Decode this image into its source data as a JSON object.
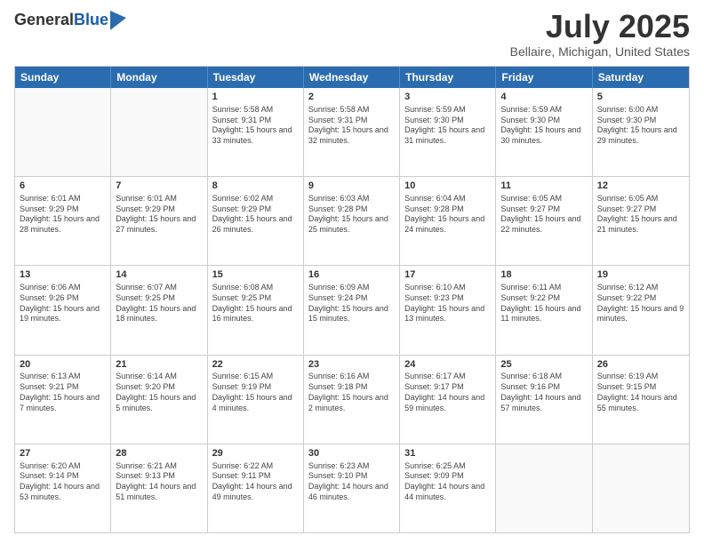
{
  "logo": {
    "general": "General",
    "blue": "Blue"
  },
  "header": {
    "month": "July 2025",
    "location": "Bellaire, Michigan, United States"
  },
  "days": [
    "Sunday",
    "Monday",
    "Tuesday",
    "Wednesday",
    "Thursday",
    "Friday",
    "Saturday"
  ],
  "weeks": [
    [
      {
        "day": "",
        "sunrise": "",
        "sunset": "",
        "daylight": ""
      },
      {
        "day": "",
        "sunrise": "",
        "sunset": "",
        "daylight": ""
      },
      {
        "day": "1",
        "sunrise": "Sunrise: 5:58 AM",
        "sunset": "Sunset: 9:31 PM",
        "daylight": "Daylight: 15 hours and 33 minutes."
      },
      {
        "day": "2",
        "sunrise": "Sunrise: 5:58 AM",
        "sunset": "Sunset: 9:31 PM",
        "daylight": "Daylight: 15 hours and 32 minutes."
      },
      {
        "day": "3",
        "sunrise": "Sunrise: 5:59 AM",
        "sunset": "Sunset: 9:30 PM",
        "daylight": "Daylight: 15 hours and 31 minutes."
      },
      {
        "day": "4",
        "sunrise": "Sunrise: 5:59 AM",
        "sunset": "Sunset: 9:30 PM",
        "daylight": "Daylight: 15 hours and 30 minutes."
      },
      {
        "day": "5",
        "sunrise": "Sunrise: 6:00 AM",
        "sunset": "Sunset: 9:30 PM",
        "daylight": "Daylight: 15 hours and 29 minutes."
      }
    ],
    [
      {
        "day": "6",
        "sunrise": "Sunrise: 6:01 AM",
        "sunset": "Sunset: 9:29 PM",
        "daylight": "Daylight: 15 hours and 28 minutes."
      },
      {
        "day": "7",
        "sunrise": "Sunrise: 6:01 AM",
        "sunset": "Sunset: 9:29 PM",
        "daylight": "Daylight: 15 hours and 27 minutes."
      },
      {
        "day": "8",
        "sunrise": "Sunrise: 6:02 AM",
        "sunset": "Sunset: 9:29 PM",
        "daylight": "Daylight: 15 hours and 26 minutes."
      },
      {
        "day": "9",
        "sunrise": "Sunrise: 6:03 AM",
        "sunset": "Sunset: 9:28 PM",
        "daylight": "Daylight: 15 hours and 25 minutes."
      },
      {
        "day": "10",
        "sunrise": "Sunrise: 6:04 AM",
        "sunset": "Sunset: 9:28 PM",
        "daylight": "Daylight: 15 hours and 24 minutes."
      },
      {
        "day": "11",
        "sunrise": "Sunrise: 6:05 AM",
        "sunset": "Sunset: 9:27 PM",
        "daylight": "Daylight: 15 hours and 22 minutes."
      },
      {
        "day": "12",
        "sunrise": "Sunrise: 6:05 AM",
        "sunset": "Sunset: 9:27 PM",
        "daylight": "Daylight: 15 hours and 21 minutes."
      }
    ],
    [
      {
        "day": "13",
        "sunrise": "Sunrise: 6:06 AM",
        "sunset": "Sunset: 9:26 PM",
        "daylight": "Daylight: 15 hours and 19 minutes."
      },
      {
        "day": "14",
        "sunrise": "Sunrise: 6:07 AM",
        "sunset": "Sunset: 9:25 PM",
        "daylight": "Daylight: 15 hours and 18 minutes."
      },
      {
        "day": "15",
        "sunrise": "Sunrise: 6:08 AM",
        "sunset": "Sunset: 9:25 PM",
        "daylight": "Daylight: 15 hours and 16 minutes."
      },
      {
        "day": "16",
        "sunrise": "Sunrise: 6:09 AM",
        "sunset": "Sunset: 9:24 PM",
        "daylight": "Daylight: 15 hours and 15 minutes."
      },
      {
        "day": "17",
        "sunrise": "Sunrise: 6:10 AM",
        "sunset": "Sunset: 9:23 PM",
        "daylight": "Daylight: 15 hours and 13 minutes."
      },
      {
        "day": "18",
        "sunrise": "Sunrise: 6:11 AM",
        "sunset": "Sunset: 9:22 PM",
        "daylight": "Daylight: 15 hours and 11 minutes."
      },
      {
        "day": "19",
        "sunrise": "Sunrise: 6:12 AM",
        "sunset": "Sunset: 9:22 PM",
        "daylight": "Daylight: 15 hours and 9 minutes."
      }
    ],
    [
      {
        "day": "20",
        "sunrise": "Sunrise: 6:13 AM",
        "sunset": "Sunset: 9:21 PM",
        "daylight": "Daylight: 15 hours and 7 minutes."
      },
      {
        "day": "21",
        "sunrise": "Sunrise: 6:14 AM",
        "sunset": "Sunset: 9:20 PM",
        "daylight": "Daylight: 15 hours and 5 minutes."
      },
      {
        "day": "22",
        "sunrise": "Sunrise: 6:15 AM",
        "sunset": "Sunset: 9:19 PM",
        "daylight": "Daylight: 15 hours and 4 minutes."
      },
      {
        "day": "23",
        "sunrise": "Sunrise: 6:16 AM",
        "sunset": "Sunset: 9:18 PM",
        "daylight": "Daylight: 15 hours and 2 minutes."
      },
      {
        "day": "24",
        "sunrise": "Sunrise: 6:17 AM",
        "sunset": "Sunset: 9:17 PM",
        "daylight": "Daylight: 14 hours and 59 minutes."
      },
      {
        "day": "25",
        "sunrise": "Sunrise: 6:18 AM",
        "sunset": "Sunset: 9:16 PM",
        "daylight": "Daylight: 14 hours and 57 minutes."
      },
      {
        "day": "26",
        "sunrise": "Sunrise: 6:19 AM",
        "sunset": "Sunset: 9:15 PM",
        "daylight": "Daylight: 14 hours and 55 minutes."
      }
    ],
    [
      {
        "day": "27",
        "sunrise": "Sunrise: 6:20 AM",
        "sunset": "Sunset: 9:14 PM",
        "daylight": "Daylight: 14 hours and 53 minutes."
      },
      {
        "day": "28",
        "sunrise": "Sunrise: 6:21 AM",
        "sunset": "Sunset: 9:13 PM",
        "daylight": "Daylight: 14 hours and 51 minutes."
      },
      {
        "day": "29",
        "sunrise": "Sunrise: 6:22 AM",
        "sunset": "Sunset: 9:11 PM",
        "daylight": "Daylight: 14 hours and 49 minutes."
      },
      {
        "day": "30",
        "sunrise": "Sunrise: 6:23 AM",
        "sunset": "Sunset: 9:10 PM",
        "daylight": "Daylight: 14 hours and 46 minutes."
      },
      {
        "day": "31",
        "sunrise": "Sunrise: 6:25 AM",
        "sunset": "Sunset: 9:09 PM",
        "daylight": "Daylight: 14 hours and 44 minutes."
      },
      {
        "day": "",
        "sunrise": "",
        "sunset": "",
        "daylight": ""
      },
      {
        "day": "",
        "sunrise": "",
        "sunset": "",
        "daylight": ""
      }
    ]
  ]
}
